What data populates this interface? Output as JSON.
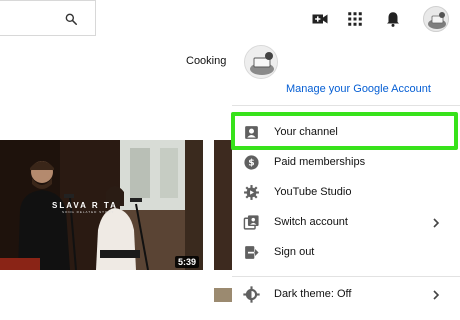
{
  "header": {
    "icons": [
      "search-icon",
      "create-video-icon",
      "apps-icon",
      "notifications-icon",
      "account-avatar"
    ]
  },
  "background": {
    "chip_label": "Cooking",
    "thumbnail": {
      "overlay_title": "SLAVA  R  TA",
      "overlay_subtitle": "SONG   RELATED   STORY",
      "duration": "5:39"
    }
  },
  "account_menu": {
    "manage_link": "Manage your Google Account",
    "items": [
      {
        "label": "Your channel",
        "icon": "person-icon"
      },
      {
        "label": "Paid memberships",
        "icon": "dollar-icon"
      },
      {
        "label": "YouTube Studio",
        "icon": "gear-icon"
      },
      {
        "label": "Switch account",
        "icon": "switch-account-icon",
        "chevron": true
      },
      {
        "label": "Sign out",
        "icon": "sign-out-icon"
      },
      {
        "label": "Dark theme: Off",
        "icon": "dark-theme-icon",
        "chevron": true
      }
    ],
    "highlighted_item": "Your channel",
    "highlight_color": "#37e21b",
    "link_color": "#065fd4"
  }
}
